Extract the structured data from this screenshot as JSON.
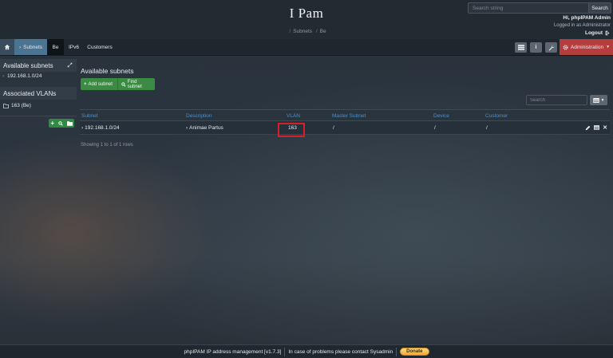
{
  "header": {
    "title": "I Pam",
    "breadcrumbs": [
      "Subnets",
      "Be"
    ],
    "search": {
      "placeholder": "Search string",
      "button_label": "Search"
    },
    "user_greeting": "Hi, phpIPAM Admin",
    "logged_in_as": "Logged in as  Administrator",
    "logout_label": "Logout"
  },
  "navbar": {
    "items": [
      "Subnets",
      "Be",
      "IPv6",
      "Customers"
    ],
    "administration_label": "Administration",
    "colors": {
      "active": "#4b7493",
      "admin": "#b53d3d"
    }
  },
  "sidebar": {
    "subnets_header": "Available subnets",
    "subnet_item": "192.168.1.0/24",
    "vlans_header": "Associated VLANs",
    "vlan_item": "163 (Be)"
  },
  "main": {
    "title": "Available subnets",
    "add_subnet_label": "Add subnet",
    "find_subnet_label": "Find subnet",
    "table_search_placeholder": "Search",
    "columns": [
      "Subnet",
      "Description",
      "VLAN",
      "Master Subnet",
      "Device",
      "Customer"
    ],
    "rows": [
      {
        "subnet": "192.168.1.0/24",
        "description": "Animae Partus",
        "vlan": "163",
        "master_subnet": "/",
        "device": "/",
        "customer": "/"
      }
    ],
    "showing_text": "Showing 1 to 1 of 1 rows",
    "highlight_color": "#d6202a"
  },
  "footer": {
    "app_version": "phpIPAM IP address management [v1.7.3]",
    "support_text": "In case of problems please contact Sysadmin",
    "donate_label": "Donate"
  }
}
